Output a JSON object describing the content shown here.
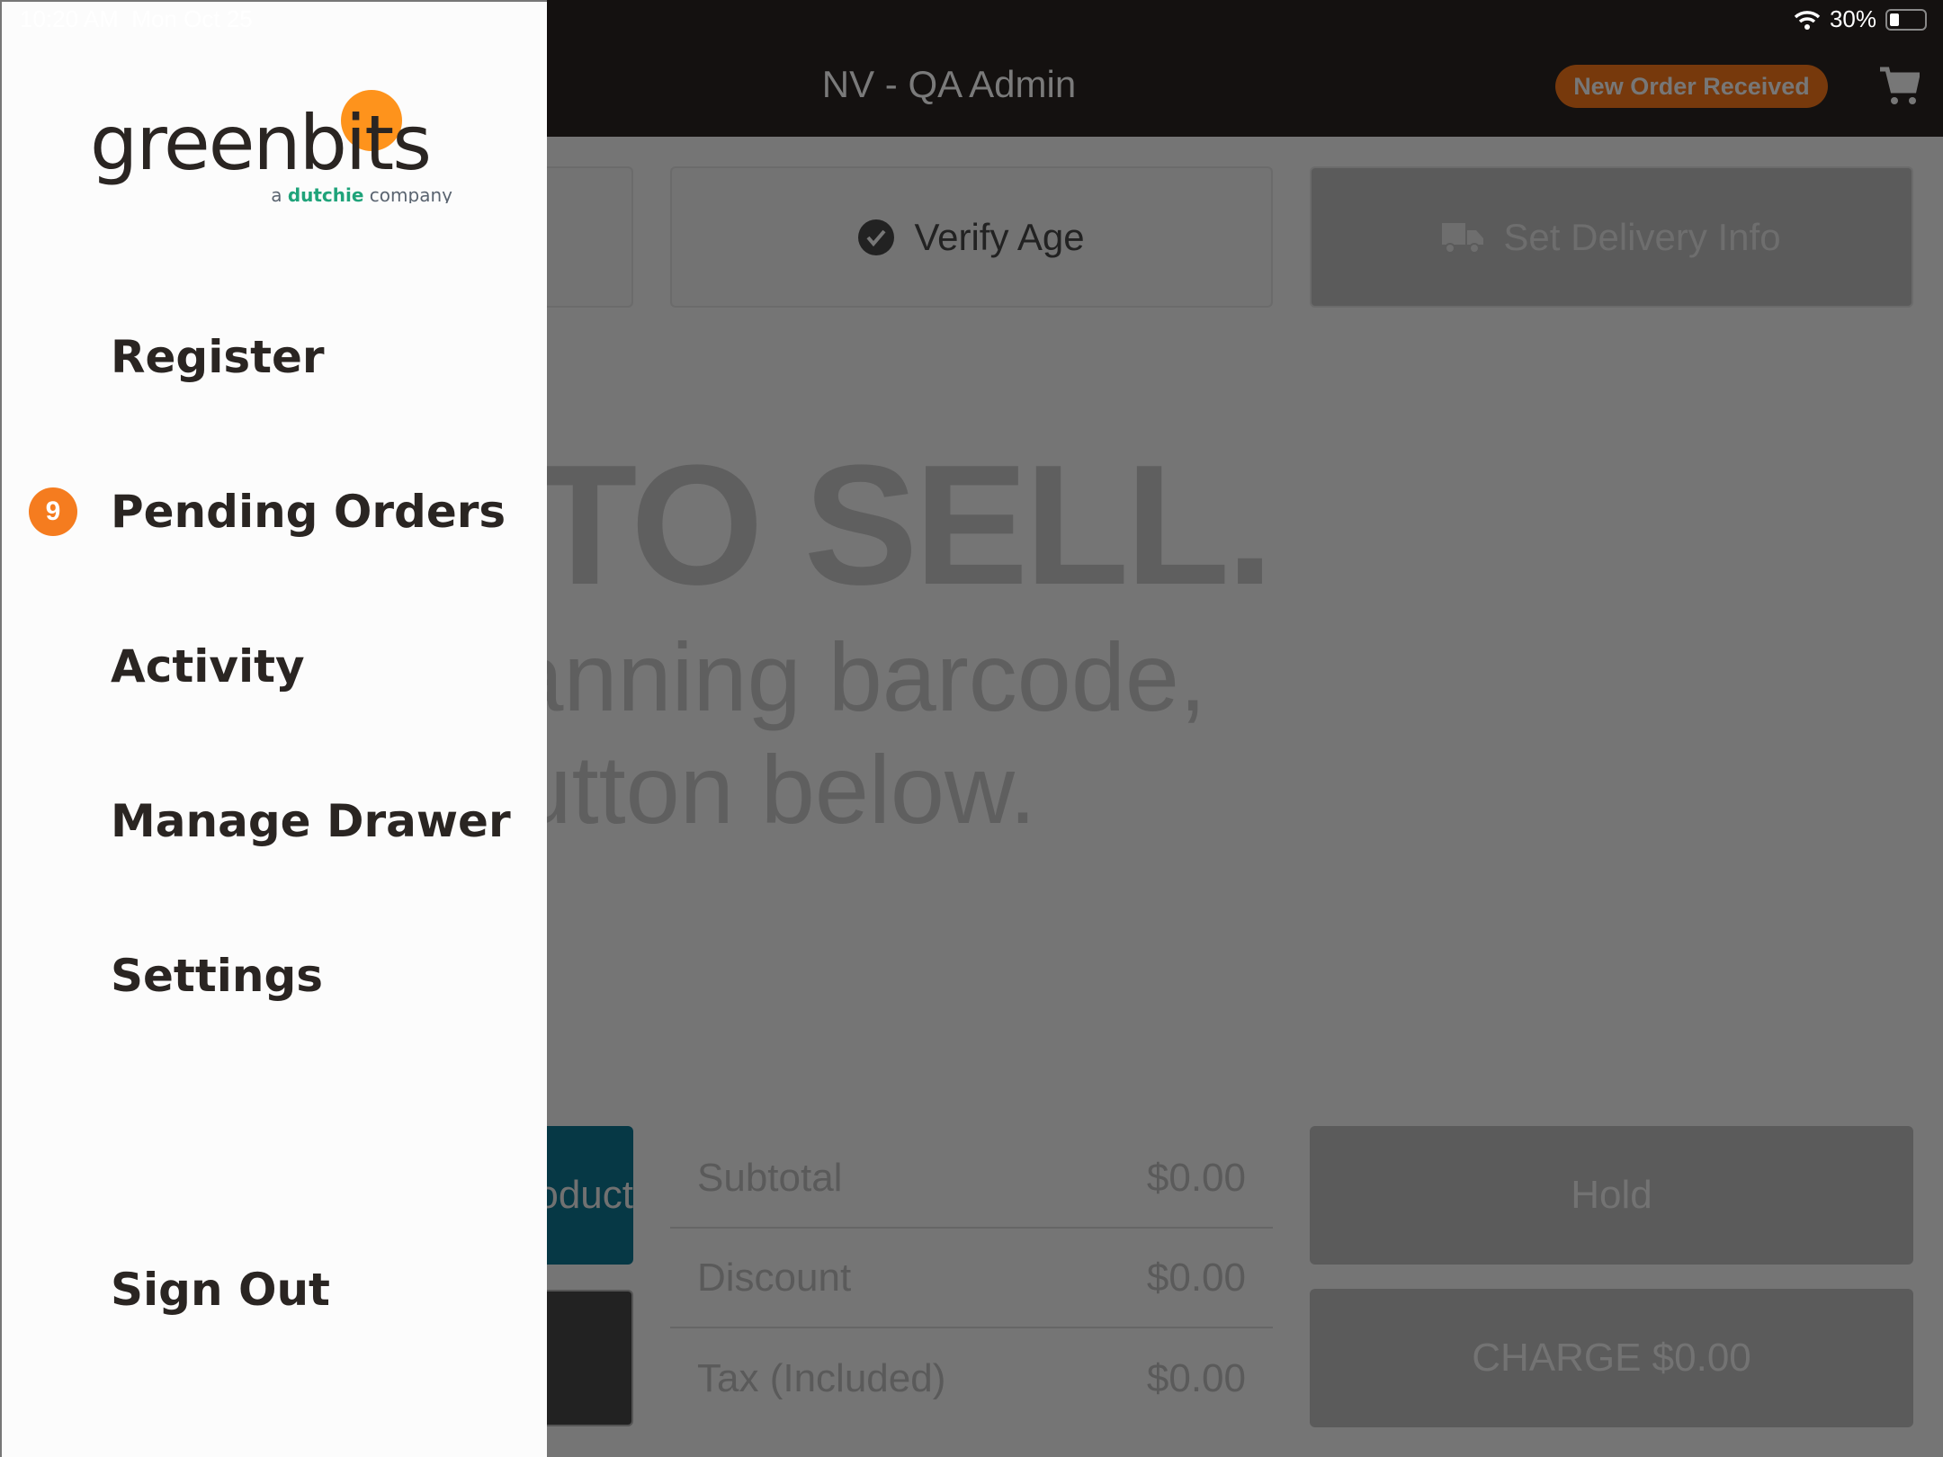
{
  "status_bar": {
    "time": "10:20 AM",
    "date": "Mon Oct 25",
    "battery": "30%",
    "battery_level": 0.3
  },
  "header": {
    "title": "NV - QA Admin",
    "notification_badge": "New Order Received",
    "cart_icon": "cart-icon"
  },
  "actions": {
    "verify_age": "Verify Age",
    "set_delivery": "Set Delivery Info"
  },
  "hero": {
    "line1": "READY TO SELL.",
    "line2": "Start by scanning barcode,",
    "line3": "or tap the button below."
  },
  "left_buttons": {
    "teal_label": "Add Product"
  },
  "totals": [
    {
      "label": "Subtotal",
      "value": "$0.00"
    },
    {
      "label": "Discount",
      "value": "$0.00"
    },
    {
      "label": "Tax (Included)",
      "value": "$0.00"
    }
  ],
  "buttons": {
    "hold": "Hold",
    "charge": "CHARGE $0.00"
  },
  "drawer": {
    "logo": {
      "brand": "greenbits",
      "tagline_prefix": "a",
      "tagline_brand": "dutchie",
      "tagline_suffix": "company"
    },
    "items": [
      {
        "label": "Register"
      },
      {
        "label": "Pending Orders",
        "badge": "9"
      },
      {
        "label": "Activity"
      },
      {
        "label": "Manage Drawer"
      },
      {
        "label": "Settings"
      }
    ],
    "sign_out": "Sign Out"
  },
  "colors": {
    "accent_orange": "#f57c1f",
    "brand_green": "#1fa37a",
    "teal": "#063845"
  }
}
